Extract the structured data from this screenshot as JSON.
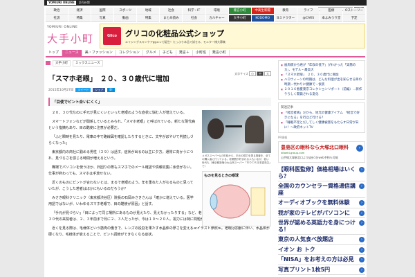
{
  "topbar": {
    "logo": "YOMIURI ONLINE",
    "sub": "読売新聞"
  },
  "search": {
    "button": "検索"
  },
  "categories": [
    {
      "label": "政治",
      "style": ""
    },
    {
      "label": "経済",
      "style": ""
    },
    {
      "label": "国際",
      "style": ""
    },
    {
      "label": "スポーツ",
      "style": ""
    },
    {
      "label": "地域",
      "style": ""
    },
    {
      "label": "社会",
      "style": ""
    },
    {
      "label": "科学・IT",
      "style": ""
    },
    {
      "label": "環境",
      "style": ""
    },
    {
      "label": "発言小町",
      "style": "green"
    },
    {
      "label": "中高生新聞",
      "style": "red"
    },
    {
      "label": "教育",
      "style": ""
    },
    {
      "label": "ライフ",
      "style": ""
    },
    {
      "label": "医療",
      "style": ""
    },
    {
      "label": "Oストーリー",
      "style": ""
    },
    {
      "label": "社説",
      "style": ""
    },
    {
      "label": "特集",
      "style": ""
    },
    {
      "label": "写真",
      "style": ""
    },
    {
      "label": "動画",
      "style": ""
    },
    {
      "label": "特集",
      "style": ""
    },
    {
      "label": "まとめ読み",
      "style": ""
    },
    {
      "label": "社会",
      "style": ""
    },
    {
      "label": "カルチャー",
      "style": ""
    },
    {
      "label": "大手小町",
      "style": "dark"
    },
    {
      "label": "KODOMO",
      "style": "blue"
    },
    {
      "label": "ヨミドクター",
      "style": ""
    },
    {
      "label": "@CARS",
      "style": ""
    },
    {
      "label": "本よみうり堂",
      "style": ""
    },
    {
      "label": "予定",
      "style": ""
    }
  ],
  "brand": {
    "yomiuri": "YOMIURI ONLINE",
    "name": "大手小町"
  },
  "ad": {
    "logo": "Glico",
    "title": "グリコの化粧品公式ショップ",
    "sub": "エイジングスキンケアggエレガ誕生！たっぷり本品で試せる、モニター様大募集"
  },
  "mainnav": [
    "トップ",
    "ニュース",
    "美・ファッション",
    "コレクション",
    "グルメ",
    "子ども",
    "発言＋",
    "小町班",
    "発言小町"
  ],
  "breadcrumb": [
    "大手小町",
    "ミックスニュース"
  ],
  "article": {
    "size_label": "文字サイズ",
    "size_small": "小",
    "size_medium": "中",
    "size_large": "大",
    "title": "「スマホ老眼」　２０、３０歳代に増加",
    "date": "2015年10月27日",
    "share_tw": "ツイート",
    "share_fb": "シェア",
    "share_ht": "B!",
    "subhead": "「目使でピント合いにくく」",
    "caption": "メガネスーパーは3年前から、手元の視力を測る検査を、全ての購入者に行っている。老眼鏡が好まれる人もいるが、若い世代も（東京都新宿の大山所スーパー「ＢＯＣＫ日本橋本店」で）",
    "fig_title": "ものを見るときの眼球",
    "paragraphs": [
      "２０、３０代なのに手元が見にくいといった老眼のような症状に悩む人が増えている。",
      "スマートフォンなどが関係しているとみられ、「スマホ老眼」と呼ばれている。新たな現代病という指摘もあり、目の酷使に注意が必要だ。",
      "「ふと瞬時を見たり、電車の中で路線図を確認したりするときに、文字がぼやけて判読しづらくなった」",
      "東京都内の商社に勤める男性（２９）は話す。症状が出るのは主に夕方。通常に向かうにつれ、見づらさを感じる時間が増えるという。",
      "職場でパソコンを使うほか、外回りの際もスマホでのメール確認や情報収集に余念がない。仕事が終わっても、スマホは手放せない。",
      "近くのものにピントが合わないとは、まるで老眼のよう。年を重ねた人がなるものと思っていたが、こうした若者はほかにもいるのだろうか？",
      "みさき眼科クリニック（東京都渋谷区）院長の石岡みさきさんは「確かに増えている。医学用語ではないが、いわゆるスマホ老眼で、目の酷使が原因」と話す。",
      "「手元が見づらい」「目によって同じ場所にあるものが見えたり、見えなかったりする」など、老眼の初期症状のような悩みを抱える２０、３０代の来院者は、２、３年前まで月に２、３人だったが、今は１０〜２０人。視力には特に問題がないことが多い。",
      "近くを見る際は、毛様体という筋肉の働きで、レンズの役割を果たす水晶体の厚さを変える≪イラスト参照≫。老眼は加齢に伴い、水晶体が硬くなり、毛様体が衰えることで、ピント調節ができなくなる症状。"
    ]
  },
  "rightcol": {
    "news": [
      "歯周病から癌が「年収の低下」がわかった「実態のカ」、モデル・最高大",
      "「スマホ老眼」　２０、３０歳代に増加",
      "ハロウィーンの時期は、どんな料理が出を知らせる目の時期・代わりに健康で・仮装",
      "２０１６春夏東京コレクションリポート（前編）…新作りらしく開発される変化"
    ],
    "sub_head": "関連記事",
    "sub_links": [
      "「経営者病」だから、地元の健康アイテム 「経営で好きになる」を行ほど行ける？",
      "「睡眠不足とだしてしく健康被害をもたらす日常が日に！～政府ネットTV"
    ],
    "pr_label": "PR情報",
    "pr_ad": {
      "title": "豊島区の眼科なら大塚北口眼科",
      "url": "kitaeki-group.com",
      "sub": "山手線大塚駅北口より徒歩1分web予約も可能"
    },
    "pr_items": [
      "【眼科医監修】価格相場はいくら？",
      "全国のカウンセラー資格通信講座",
      "オーディオブックを無料体験",
      "我が家のテレビがパソコンに",
      "世界が認める英語力を身につける！",
      "東京の人気食べ放題店",
      "イオン お トク",
      "「NISA」をお考えの方は必見",
      "写真プリント1枚5円"
    ]
  }
}
